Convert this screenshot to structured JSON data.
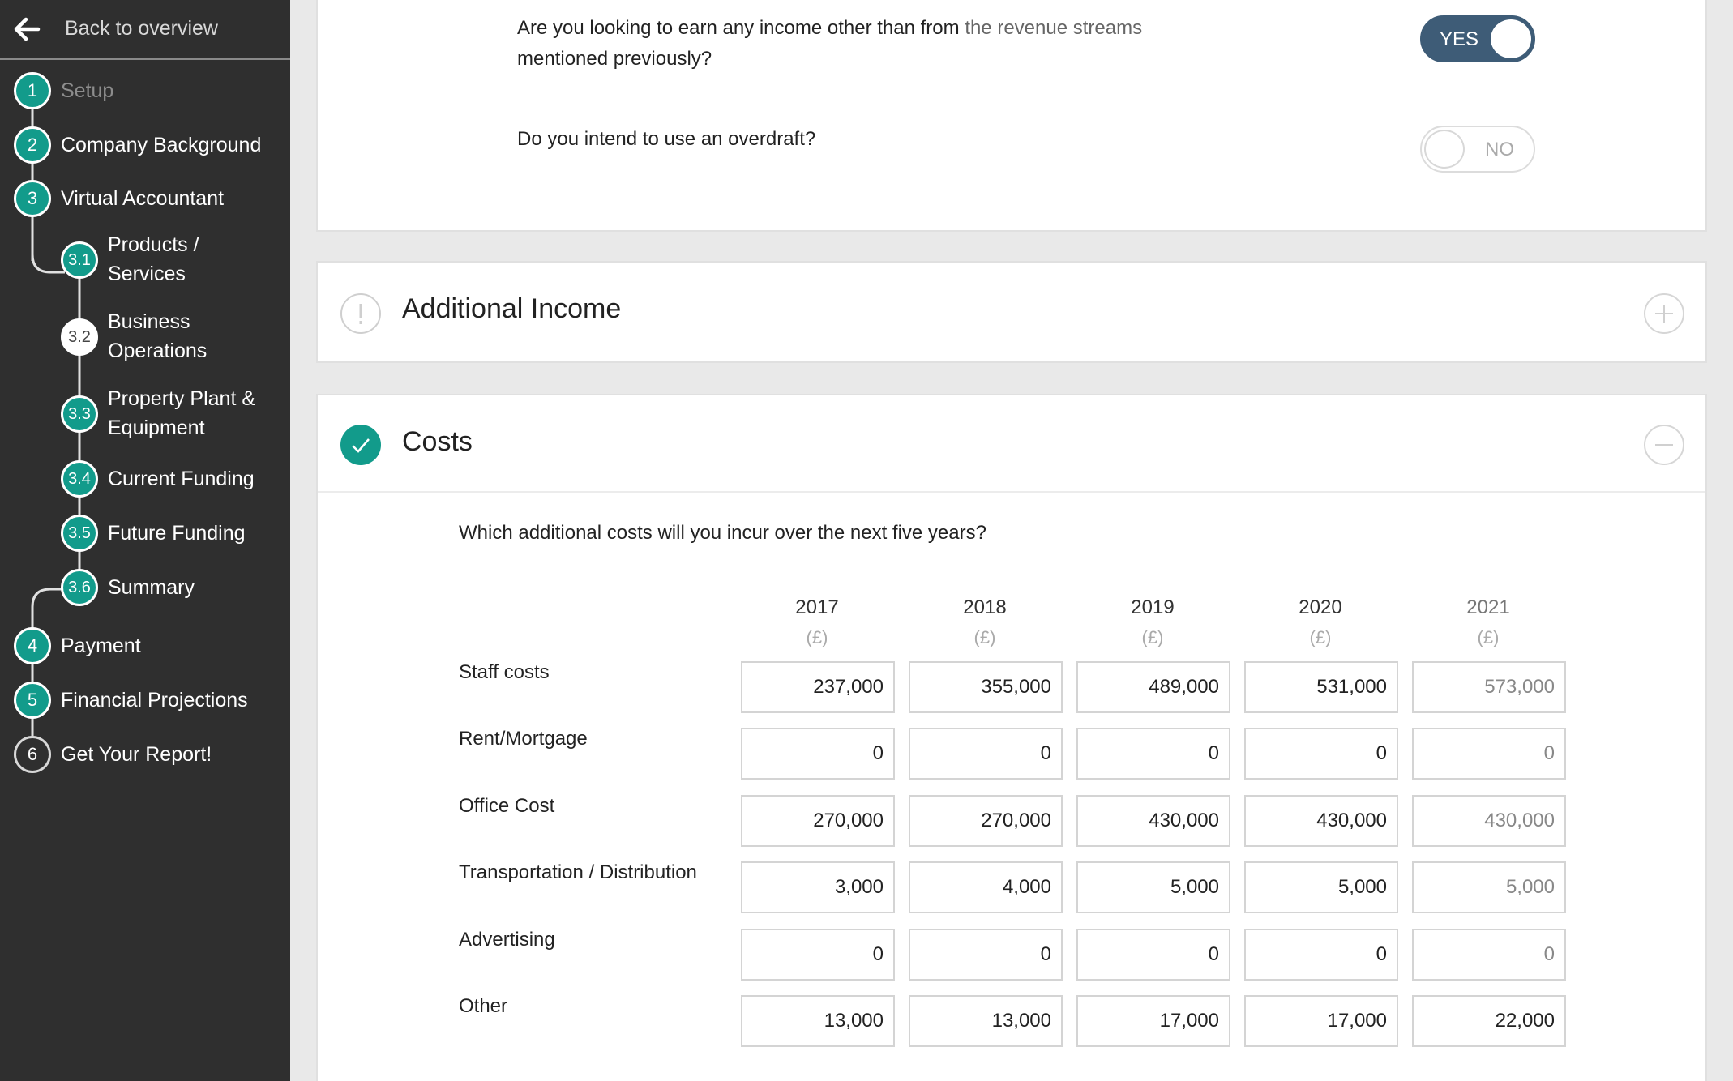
{
  "sidebar": {
    "back_label": "Back to overview",
    "steps": [
      {
        "num": "1",
        "label": "Setup",
        "state": "done-dim"
      },
      {
        "num": "2",
        "label": "Company Background",
        "state": "done"
      },
      {
        "num": "3",
        "label": "Virtual Accountant",
        "state": "done"
      },
      {
        "num": "3.1",
        "label": "Products / Services",
        "state": "done"
      },
      {
        "num": "3.2",
        "label": "Business Operations",
        "state": "current"
      },
      {
        "num": "3.3",
        "label": "Property Plant & Equipment",
        "state": "done"
      },
      {
        "num": "3.4",
        "label": "Current Funding",
        "state": "done"
      },
      {
        "num": "3.5",
        "label": "Future Funding",
        "state": "done"
      },
      {
        "num": "3.6",
        "label": "Summary",
        "state": "done"
      },
      {
        "num": "4",
        "label": "Payment",
        "state": "done"
      },
      {
        "num": "5",
        "label": "Financial Projections",
        "state": "done"
      },
      {
        "num": "6",
        "label": "Get Your Report!",
        "state": "outline"
      }
    ]
  },
  "questions": {
    "q1_text_a": "Are you looking to earn any income other than from",
    "q1_text_link": "the revenue streams",
    "q1_text_b": "mentioned previously?",
    "q1_toggle": "YES",
    "q2_text": "Do you intend to use an overdraft?",
    "q2_toggle": "NO"
  },
  "additional_income": {
    "title": "Additional Income"
  },
  "costs": {
    "title": "Costs",
    "question": "Which additional costs will you incur over the next five years?",
    "years": [
      "2017",
      "2018",
      "2019",
      "2020",
      "2021"
    ],
    "unit": "(£)",
    "rows": [
      {
        "label": "Staff costs",
        "values": [
          "237,000",
          "355,000",
          "489,000",
          "531,000",
          "573,000"
        ]
      },
      {
        "label": "Rent/Mortgage",
        "values": [
          "0",
          "0",
          "0",
          "0",
          "0"
        ]
      },
      {
        "label": "Office Cost",
        "values": [
          "270,000",
          "270,000",
          "430,000",
          "430,000",
          "430,000"
        ]
      },
      {
        "label": "Transportation / Distribution",
        "values": [
          "3,000",
          "4,000",
          "5,000",
          "5,000",
          "5,000"
        ]
      },
      {
        "label": "Advertising",
        "values": [
          "0",
          "0",
          "0",
          "0",
          "0"
        ]
      },
      {
        "label": "Other",
        "values": [
          "13,000",
          "13,000",
          "17,000",
          "17,000",
          "22,000"
        ]
      }
    ]
  },
  "colors": {
    "accent": "#129b8b",
    "sidebar": "#2f2f2f",
    "toggle_on": "#3e5c77"
  }
}
